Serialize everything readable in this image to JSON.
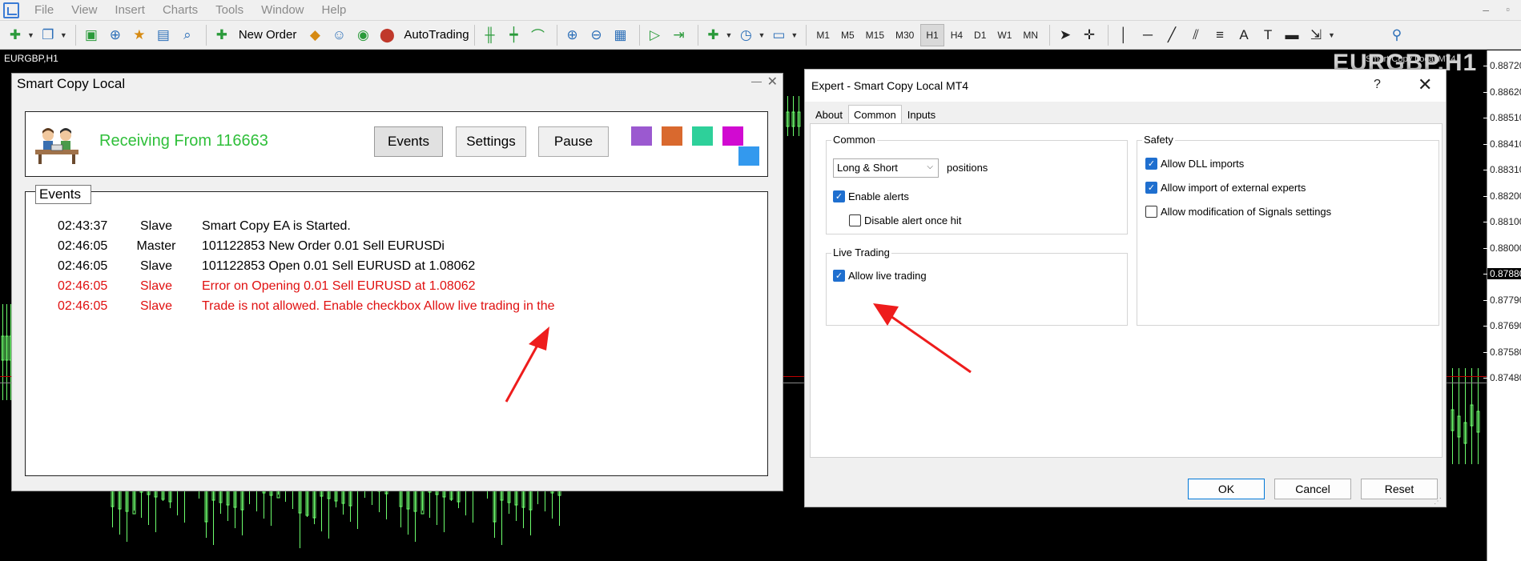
{
  "menubar": {
    "items": [
      "File",
      "View",
      "Insert",
      "Charts",
      "Tools",
      "Window",
      "Help"
    ],
    "minimize": "–",
    "restore": "▫"
  },
  "toolbar": {
    "new_order": "New Order",
    "autotrading": "AutoTrading",
    "timeframes": [
      "M1",
      "M5",
      "M15",
      "M30",
      "H1",
      "H4",
      "D1",
      "W1",
      "MN"
    ],
    "active_timeframe": "H1"
  },
  "chart": {
    "symbol_title": "EURGBP,H1",
    "watermark": "EURGBP,H1",
    "ea_label": "Smart Copy Local MT4",
    "price_ticks": [
      "0.88720",
      "0.88620",
      "0.88510",
      "0.88410",
      "0.88310",
      "0.88200",
      "0.88100",
      "0.88000",
      "0.87880",
      "0.87790",
      "0.87690",
      "0.87580",
      "0.87480"
    ],
    "current_price": "0.87880",
    "candle_color": "#6dff6d",
    "level_line_color": "#c00000"
  },
  "scl": {
    "title": "Smart Copy Local",
    "minimize": "—",
    "close": "✕",
    "receiving_text": "Receiving From 116663",
    "receiving_color": "#2fbf3a",
    "buttons": [
      "Events",
      "Settings",
      "Pause"
    ],
    "swatches": [
      "#9b59d0",
      "#d9692e",
      "#2ed09a",
      "#d10ad1",
      "#3399ee"
    ],
    "events_label": "Events",
    "events": [
      {
        "time": "02:43:37",
        "role": "Slave",
        "message": "Smart Copy EA is Started.",
        "error": false
      },
      {
        "time": "02:46:05",
        "role": "Master",
        "message": "101122853 New Order 0.01 Sell EURUSDi",
        "error": false
      },
      {
        "time": "02:46:05",
        "role": "Slave",
        "message": "101122853 Open 0.01 Sell EURUSD at 1.08062",
        "error": false
      },
      {
        "time": "02:46:05",
        "role": "Slave",
        "message": "Error on Opening 0.01 Sell EURUSD at 1.08062",
        "error": true
      },
      {
        "time": "02:46:05",
        "role": "Slave",
        "message": "Trade is not allowed. Enable checkbox Allow live trading in the",
        "error": true
      }
    ],
    "error_color": "#e01010"
  },
  "dialog": {
    "title": "Expert - Smart Copy Local MT4",
    "help": "?",
    "close": "✕",
    "tabs": [
      "About",
      "Common",
      "Inputs"
    ],
    "active_tab": "Common",
    "common": {
      "label": "Common",
      "positions_value": "Long & Short",
      "positions_label": "positions",
      "enable_alerts": {
        "label": "Enable alerts",
        "checked": true
      },
      "disable_alert_once": {
        "label": "Disable alert once hit",
        "checked": false
      }
    },
    "live_trading": {
      "label": "Live Trading",
      "allow_live_trading": {
        "label": "Allow live trading",
        "checked": true
      }
    },
    "safety": {
      "label": "Safety",
      "allow_dll": {
        "label": "Allow DLL imports",
        "checked": true
      },
      "allow_external": {
        "label": "Allow import of external experts",
        "checked": true
      },
      "allow_signals": {
        "label": "Allow modification of Signals settings",
        "checked": false
      }
    },
    "buttons": {
      "ok": "OK",
      "cancel": "Cancel",
      "reset": "Reset"
    }
  },
  "annotation_color": "#ee1c1c"
}
